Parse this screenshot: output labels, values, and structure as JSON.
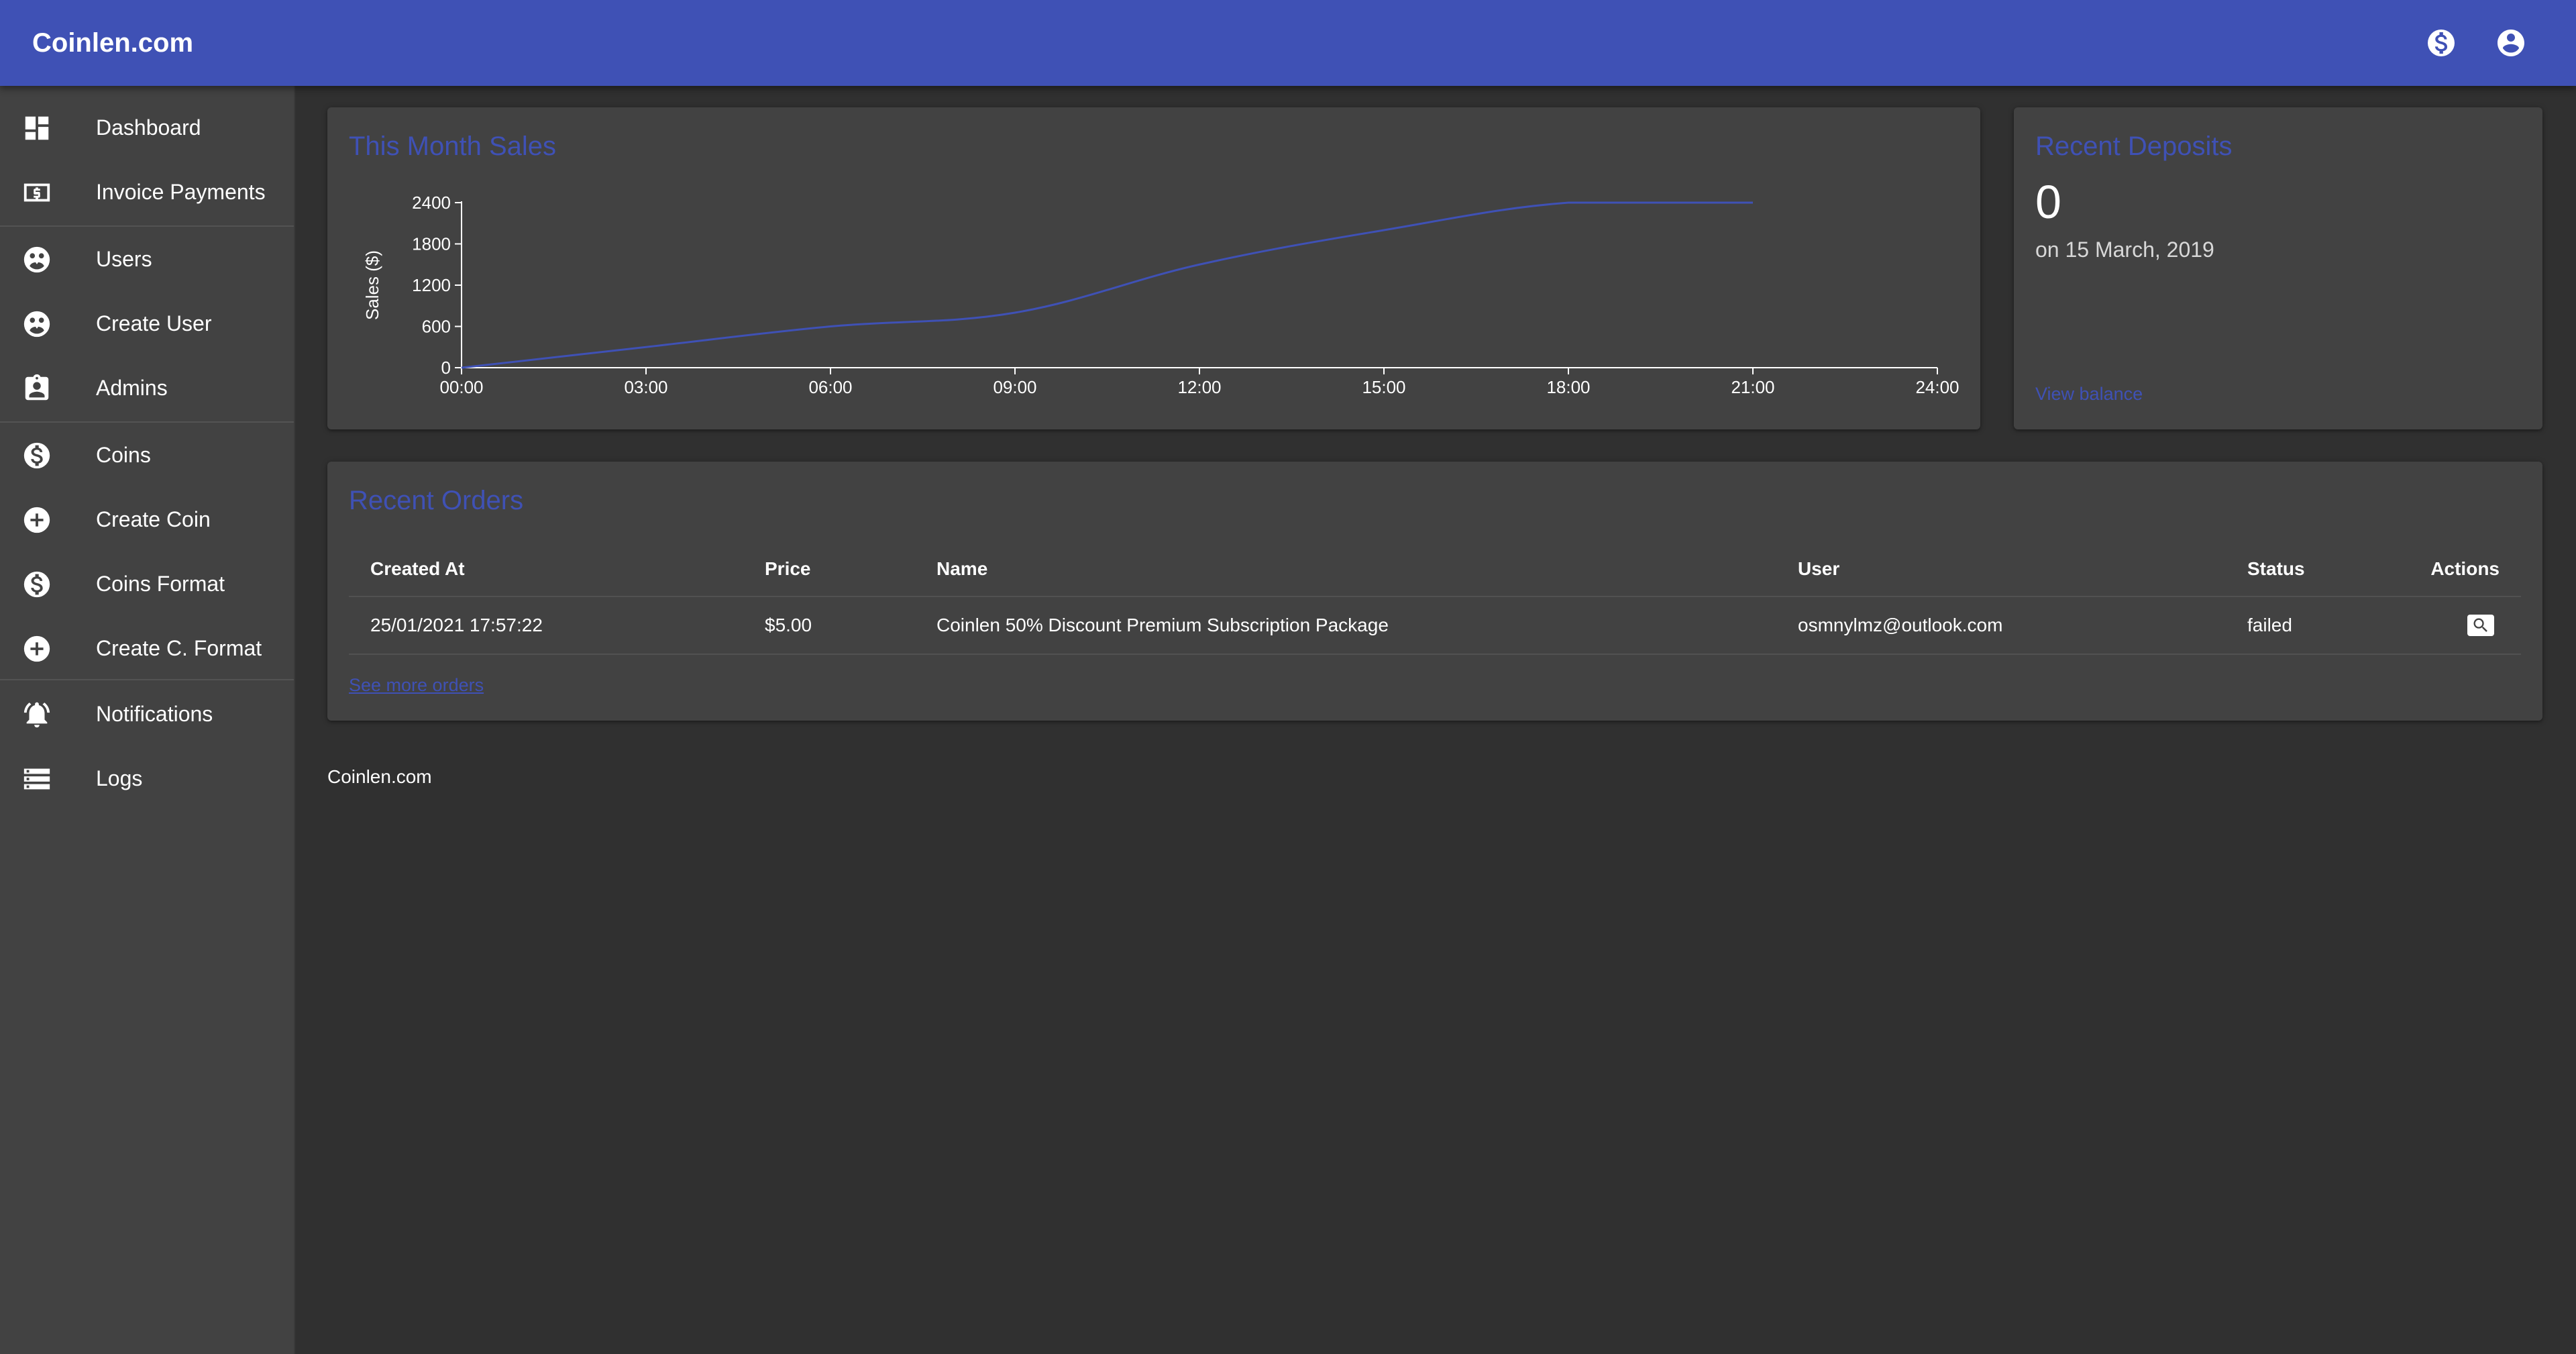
{
  "app": {
    "title": "Coinlen.com"
  },
  "appbar": {
    "coin_icon": "dollar-circle-icon",
    "account_icon": "account-circle-icon"
  },
  "sidebar": {
    "items": [
      {
        "label": "Dashboard",
        "icon": "dashboard-icon"
      },
      {
        "label": "Invoice Payments",
        "icon": "invoice-payments-icon"
      },
      {
        "label": "Users",
        "icon": "users-icon"
      },
      {
        "label": "Create User",
        "icon": "create-user-icon"
      },
      {
        "label": "Admins",
        "icon": "admins-icon"
      },
      {
        "label": "Coins",
        "icon": "coins-icon"
      },
      {
        "label": "Create Coin",
        "icon": "add-circle-icon"
      },
      {
        "label": "Coins Format",
        "icon": "coins-format-icon"
      },
      {
        "label": "Create C. Format",
        "icon": "add-circle-icon"
      },
      {
        "label": "Notifications",
        "icon": "notifications-icon"
      },
      {
        "label": "Logs",
        "icon": "logs-icon"
      }
    ]
  },
  "sales": {
    "title": "This Month Sales"
  },
  "chart_data": {
    "type": "line",
    "title": "This Month Sales",
    "xlabel": "",
    "ylabel": "Sales ($)",
    "categories": [
      "00:00",
      "03:00",
      "06:00",
      "09:00",
      "12:00",
      "15:00",
      "18:00",
      "21:00",
      "24:00"
    ],
    "x": [
      "00:00",
      "03:00",
      "06:00",
      "09:00",
      "12:00",
      "15:00",
      "18:00",
      "21:00"
    ],
    "values": [
      0,
      300,
      600,
      800,
      1500,
      2000,
      2400,
      2400
    ],
    "yticks": [
      0,
      600,
      1200,
      1800,
      2400
    ],
    "ylim": [
      0,
      2400
    ],
    "grid": false,
    "line_color": "#3f51b5"
  },
  "deposits": {
    "title": "Recent Deposits",
    "amount": "0",
    "date": "on 15 March, 2019",
    "link": "View balance"
  },
  "orders": {
    "title": "Recent Orders",
    "columns": {
      "created": "Created At",
      "price": "Price",
      "name": "Name",
      "user": "User",
      "status": "Status",
      "actions": "Actions"
    },
    "rows": [
      {
        "created": "25/01/2021 17:57:22",
        "price": "$5.00",
        "name": "Coinlen 50% Discount Premium Subscription Package",
        "user": "osmnylmz@outlook.com",
        "status": "failed",
        "action_icon": "search-icon"
      }
    ],
    "more_link": "See more orders"
  },
  "footer": {
    "text": "Coinlen.com"
  }
}
